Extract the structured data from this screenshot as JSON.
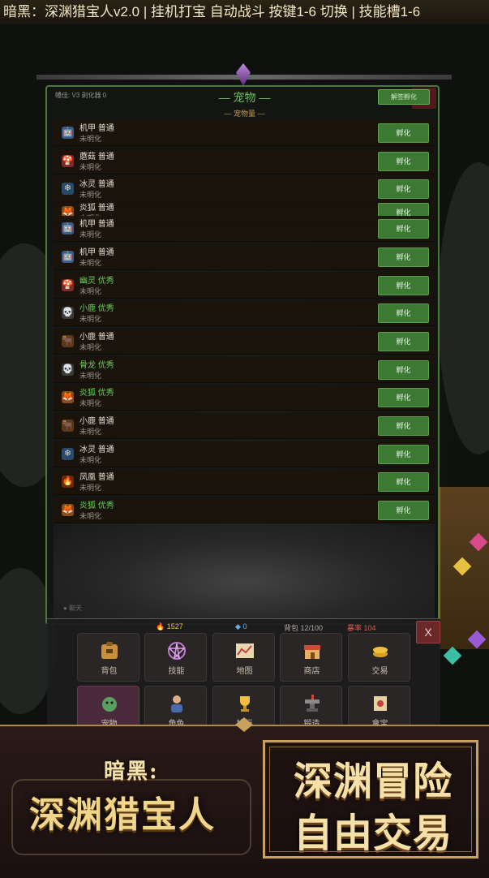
{
  "topbar": {
    "text": "暗黑：深渊猎宝人v2.0 | 挂机打宝 自动战斗 按键1-6 切换 | 技能槽1-6"
  },
  "panel": {
    "header_left": "幡佳: V3 剥化器 0",
    "title": "— 宠物 —",
    "subtitle": "— 宠物量 —",
    "batch_button": "解签孵化"
  },
  "pets": [
    {
      "name": "机甲 普通",
      "status": "未明化",
      "icon": "robot-icon",
      "quality": "normal",
      "action": "孵化"
    },
    {
      "name": "蘑菇 普通",
      "status": "未明化",
      "icon": "mushroom-icon",
      "quality": "normal",
      "action": "孵化"
    },
    {
      "name": "冰灵 普通",
      "status": "未明化",
      "icon": "snowflake-icon",
      "quality": "normal",
      "action": "孵化"
    },
    {
      "name": "炎狐 普通",
      "status": "未明化",
      "icon": "fox-icon",
      "quality": "normal",
      "action": "孵化"
    },
    {
      "name": "机甲 普通",
      "status": "未明化",
      "icon": "robot-icon",
      "quality": "normal",
      "action": "孵化"
    },
    {
      "name": "机甲 普通",
      "status": "未明化",
      "icon": "robot-icon",
      "quality": "normal",
      "action": "孵化"
    },
    {
      "name": "幽灵 优秀",
      "status": "未明化",
      "icon": "mushroom-icon",
      "quality": "good",
      "action": "孵化"
    },
    {
      "name": "小鹿 优秀",
      "status": "未明化",
      "icon": "skull-icon",
      "quality": "good",
      "action": "孵化"
    },
    {
      "name": "小鹿 普通",
      "status": "未明化",
      "icon": "ox-icon",
      "quality": "normal",
      "action": "孵化"
    },
    {
      "name": "骨龙 优秀",
      "status": "未明化",
      "icon": "skull-icon",
      "quality": "good",
      "action": "孵化"
    },
    {
      "name": "炎狐 优秀",
      "status": "未明化",
      "icon": "fox-icon",
      "quality": "good",
      "action": "孵化"
    },
    {
      "name": "小鹿 普通",
      "status": "未明化",
      "icon": "ox-icon",
      "quality": "normal",
      "action": "孵化"
    },
    {
      "name": "冰灵 普通",
      "status": "未明化",
      "icon": "snowflake-icon",
      "quality": "normal",
      "action": "孵化"
    },
    {
      "name": "凤凰 普通",
      "status": "未明化",
      "icon": "flame-icon",
      "quality": "normal",
      "action": "孵化"
    },
    {
      "name": "炎狐 优秀",
      "status": "未明化",
      "icon": "fox-icon",
      "quality": "good",
      "action": "孵化"
    }
  ],
  "chat_hint": "● 聊天",
  "resources": {
    "gold": "1527",
    "diamond": "0",
    "bag": "背包 12/100",
    "crit": "暴率 104",
    "close": "X"
  },
  "menu_row1": [
    {
      "label": "背包",
      "icon": "backpack-icon"
    },
    {
      "label": "技能",
      "icon": "pentagram-icon"
    },
    {
      "label": "地图",
      "icon": "map-icon"
    },
    {
      "label": "商店",
      "icon": "shop-icon"
    },
    {
      "label": "交易",
      "icon": "coins-icon"
    }
  ],
  "menu_row2": [
    {
      "label": "宠物",
      "icon": "pet-icon"
    },
    {
      "label": "角色",
      "icon": "character-icon"
    },
    {
      "label": "排行",
      "icon": "trophy-icon"
    },
    {
      "label": "锻造",
      "icon": "anvil-icon"
    },
    {
      "label": "拿宝",
      "icon": "scroll-icon"
    }
  ],
  "banner": {
    "logo_top": "暗黑:",
    "logo_main": "深渊猎宝人",
    "slogan_line1": "深渊冒险",
    "slogan_line2": "自由交易"
  },
  "colors": {
    "accent_green": "#3c7a34",
    "good_quality": "#6ad05a",
    "gold_text": "#f0d68a",
    "close_red": "#6a2828"
  }
}
